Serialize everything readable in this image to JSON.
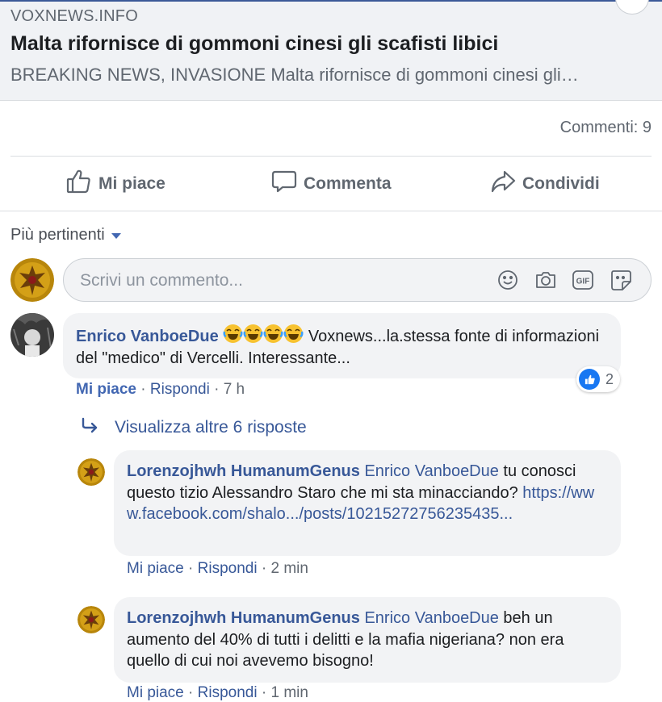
{
  "link_preview": {
    "domain": "VOXNEWS.INFO",
    "title": "Malta rifornisce di gommoni cinesi gli scafisti libici",
    "description": "BREAKING NEWS, INVASIONE Malta rifornisce di gommoni cinesi gli…"
  },
  "stats": {
    "comments": "Commenti: 9"
  },
  "actions": {
    "like": "Mi piace",
    "comment": "Commenta",
    "share": "Condividi"
  },
  "sort": {
    "label": "Più pertinenti"
  },
  "composer": {
    "placeholder": "Scrivi un commento...",
    "icons": [
      "smiley-icon",
      "camera-icon",
      "gif-icon",
      "sticker-icon"
    ]
  },
  "comments": [
    {
      "author": "Enrico VanboeDue",
      "emojis": [
        "face-with-tears-of-joy",
        "face-with-tears-of-joy",
        "face-with-tears-of-joy",
        "face-with-tears-of-joy"
      ],
      "text": " Voxnews...la.stessa fonte di informazioni del \"medico\" di Vercelli. Interessante...",
      "like_label": "Mi piace",
      "reply_label": "Rispondi",
      "time": "7 h",
      "reactions_count": "2",
      "more_replies": "Visualizza altre 6 risposte"
    }
  ],
  "replies": [
    {
      "author": "Lorenzojhwh HumanumGenus",
      "mention": "Enrico VanboeDue",
      "text": " tu conosci questo tizio Alessandro Staro che mi sta minacciando? ",
      "link": "https://www.facebook.com/shalo.../posts/10215272756235435...",
      "like_label": "Mi piace",
      "reply_label": "Rispondi",
      "time": "2 min"
    },
    {
      "author": "Lorenzojhwh HumanumGenus",
      "mention": "Enrico VanboeDue",
      "text": " beh un aumento del 40% di tutti i delitti e la mafia nigeriana? non era quello di cui noi avevemo bisogno!",
      "like_label": "Mi piace",
      "reply_label": "Rispondi",
      "time": "1 min"
    }
  ],
  "colors": {
    "link": "#385898",
    "accent": "#4267b2",
    "muted": "#606770",
    "bubble": "#f2f3f5"
  }
}
